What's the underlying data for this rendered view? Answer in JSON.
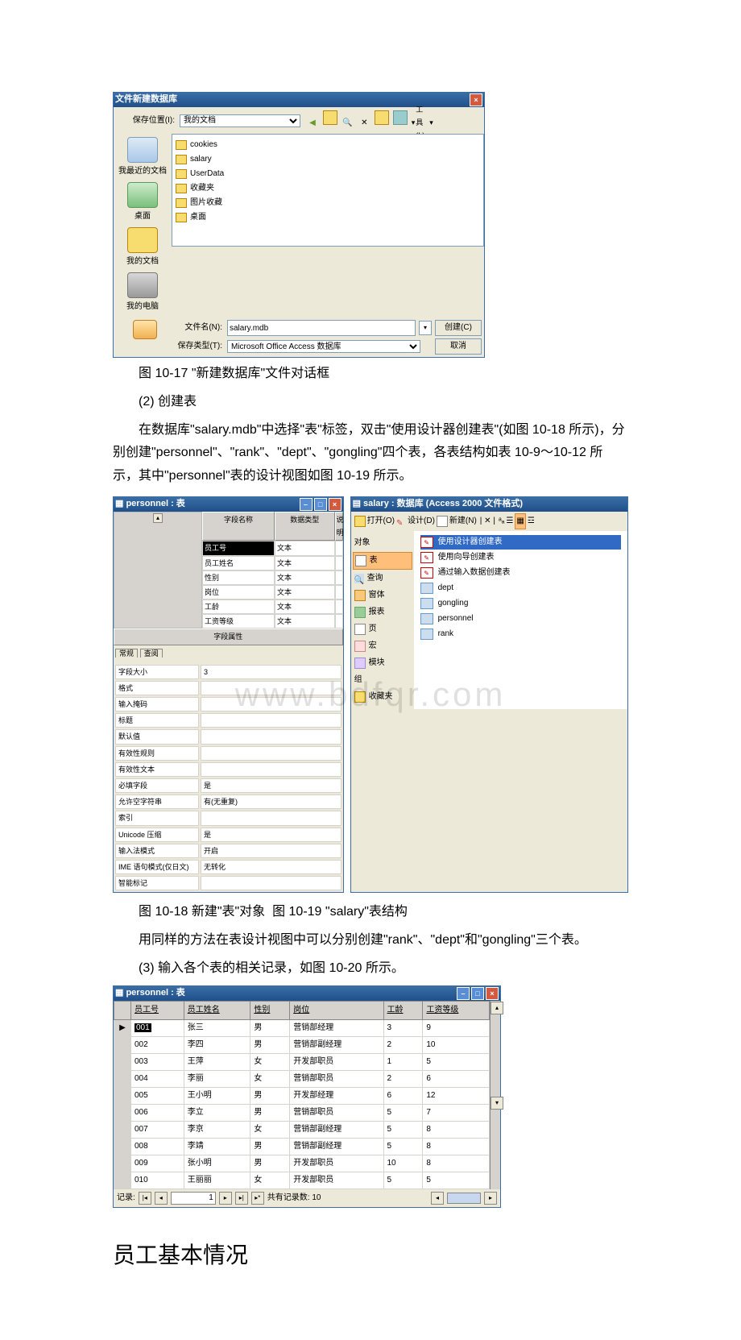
{
  "dialog1": {
    "title": "文件新建数据库",
    "save_loc_label": "保存位置(I):",
    "save_loc_value": "我的文档",
    "tools_label": "工具(L)",
    "sidebar": [
      {
        "label": "我最近的文档"
      },
      {
        "label": "桌面"
      },
      {
        "label": "我的文档"
      },
      {
        "label": "我的电脑"
      }
    ],
    "folders": [
      "cookies",
      "salary",
      "UserData",
      "收藏夹",
      "图片收藏",
      "桌面"
    ],
    "filename_label": "文件名(N):",
    "filename_value": "salary.mdb",
    "type_label": "保存类型(T):",
    "type_value": "Microsoft Office Access 数据库",
    "create": "创建(C)",
    "cancel": "取消"
  },
  "cap1": "图 10-17 \"新建数据库\"文件对话框",
  "para2": "(2) 创建表",
  "para3": "在数据库\"salary.mdb\"中选择\"表\"标签，双击\"使用设计器创建表\"(如图 10-18 所示)，分别创建\"personnel\"、\"rank\"、\"dept\"、\"gongling\"四个表，各表结构如表 10-9～10-12 所示，其中\"personnel\"表的设计视图如图 10-19 所示。",
  "design": {
    "title": "personnel : 表",
    "head": [
      "字段名称",
      "数据类型",
      "说明"
    ],
    "rows": [
      [
        "员工号",
        "文本",
        ""
      ],
      [
        "员工姓名",
        "文本",
        ""
      ],
      [
        "性别",
        "文本",
        ""
      ],
      [
        "岗位",
        "文本",
        ""
      ],
      [
        "工龄",
        "文本",
        ""
      ],
      [
        "工资等级",
        "文本",
        ""
      ]
    ],
    "section": "字段属性",
    "tabs": [
      "常规",
      "查阅"
    ],
    "props": [
      [
        "字段大小",
        "3"
      ],
      [
        "格式",
        ""
      ],
      [
        "输入掩码",
        ""
      ],
      [
        "标题",
        ""
      ],
      [
        "默认值",
        ""
      ],
      [
        "有效性规则",
        ""
      ],
      [
        "有效性文本",
        ""
      ],
      [
        "必填字段",
        "是"
      ],
      [
        "允许空字符串",
        "有(无重复)"
      ],
      [
        "索引",
        ""
      ],
      [
        "Unicode 压缩",
        "是"
      ],
      [
        "输入法模式",
        "开启"
      ],
      [
        "IME 语句模式(仅日文)",
        "无转化"
      ],
      [
        "智能标记",
        ""
      ]
    ]
  },
  "db": {
    "title": "salary : 数据库  (Access 2000 文件格式)",
    "tb": [
      "打开(O)",
      "设计(D)",
      "新建(N)"
    ],
    "nav": [
      "对象",
      "表",
      "查询",
      "窗体",
      "报表",
      "页",
      "宏",
      "模块",
      "组",
      "收藏夹"
    ],
    "items": [
      "使用设计器创建表",
      "使用向导创建表",
      "通过输入数据创建表",
      "dept",
      "gongling",
      "personnel",
      "rank"
    ]
  },
  "watermark": "www.bdfqr.com",
  "cap2a": "图 10-18 新建\"表\"对象",
  "cap2b": "图 10-19 \"salary\"表结构",
  "para4": "用同样的方法在表设计视图中可以分别创建\"rank\"、\"dept\"和\"gongling\"三个表。",
  "para5": "(3) 输入各个表的相关记录，如图 10-20 所示。",
  "dataview": {
    "title": "personnel : 表",
    "cols": [
      "员工号",
      "员工姓名",
      "性别",
      "岗位",
      "工龄",
      "工资等级"
    ],
    "rows": [
      [
        "001",
        "张三",
        "男",
        "营销部经理",
        "3",
        "9"
      ],
      [
        "002",
        "李四",
        "男",
        "营销部副经理",
        "2",
        "10"
      ],
      [
        "003",
        "王萍",
        "女",
        "开发部职员",
        "1",
        "5"
      ],
      [
        "004",
        "李丽",
        "女",
        "营销部职员",
        "2",
        "6"
      ],
      [
        "005",
        "王小明",
        "男",
        "开发部经理",
        "6",
        "12"
      ],
      [
        "006",
        "李立",
        "男",
        "营销部职员",
        "5",
        "7"
      ],
      [
        "007",
        "李京",
        "女",
        "营销部副经理",
        "5",
        "8"
      ],
      [
        "008",
        "李靖",
        "男",
        "营销部副经理",
        "5",
        "8"
      ],
      [
        "009",
        "张小明",
        "男",
        "开发部职员",
        "10",
        "8"
      ],
      [
        "010",
        "王丽丽",
        "女",
        "开发部职员",
        "5",
        "5"
      ]
    ],
    "nav_label": "记录:",
    "pos": "1",
    "total_label": "共有记录数: 10"
  },
  "bigtitle": "员工基本情况"
}
